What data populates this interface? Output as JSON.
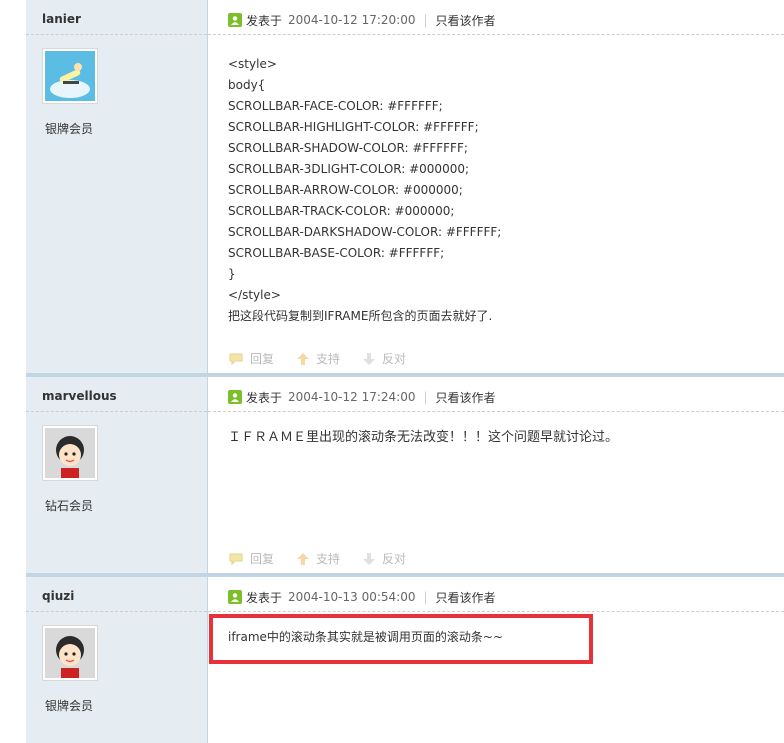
{
  "posts": [
    {
      "author": "lanier",
      "rank": "银牌会员",
      "avatar_icon": "skateboarder-avatar-icon",
      "posted_label": "发表于",
      "time": "2004-10-12 17:20:00",
      "only_author": "只看该作者",
      "content": [
        "<style>",
        "body{",
        "SCROLLBAR-FACE-COLOR: #FFFFFF;",
        "SCROLLBAR-HIGHLIGHT-COLOR: #FFFFFF;",
        "SCROLLBAR-SHADOW-COLOR: #FFFFFF;",
        "SCROLLBAR-3DLIGHT-COLOR: #000000;",
        "SCROLLBAR-ARROW-COLOR: #000000;",
        "SCROLLBAR-TRACK-COLOR: #000000;",
        "SCROLLBAR-DARKSHADOW-COLOR: #FFFFFF;",
        "SCROLLBAR-BASE-COLOR: #FFFFFF;",
        "}",
        "</style>",
        "把这段代码复制到IFRAME所包含的页面去就好了."
      ],
      "actions": {
        "reply": "回复",
        "support": "支持",
        "oppose": "反对"
      }
    },
    {
      "author": "marvellous",
      "rank": "钻石会员",
      "avatar_icon": "cartoon-kid-avatar-icon",
      "posted_label": "发表于",
      "time": "2004-10-12 17:24:00",
      "only_author": "只看该作者",
      "content": [
        "ＩＦＲＡＭＥ里出现的滚动条无法改变！！！这个问题早就讨论过。"
      ],
      "actions": {
        "reply": "回复",
        "support": "支持",
        "oppose": "反对"
      }
    },
    {
      "author": "qiuzi",
      "rank": "银牌会员",
      "avatar_icon": "cartoon-kid-avatar-icon",
      "posted_label": "发表于",
      "time": "2004-10-13 00:54:00",
      "only_author": "只看该作者",
      "content": [
        "iframe中的滚动条其实就是被调用页面的滚动条~~"
      ]
    }
  ],
  "colors": {
    "sidebar_bg": "#e5edf2",
    "border": "#c2d5e3",
    "highlight": "#e8323a",
    "post_icon": "#7cbf2a"
  }
}
